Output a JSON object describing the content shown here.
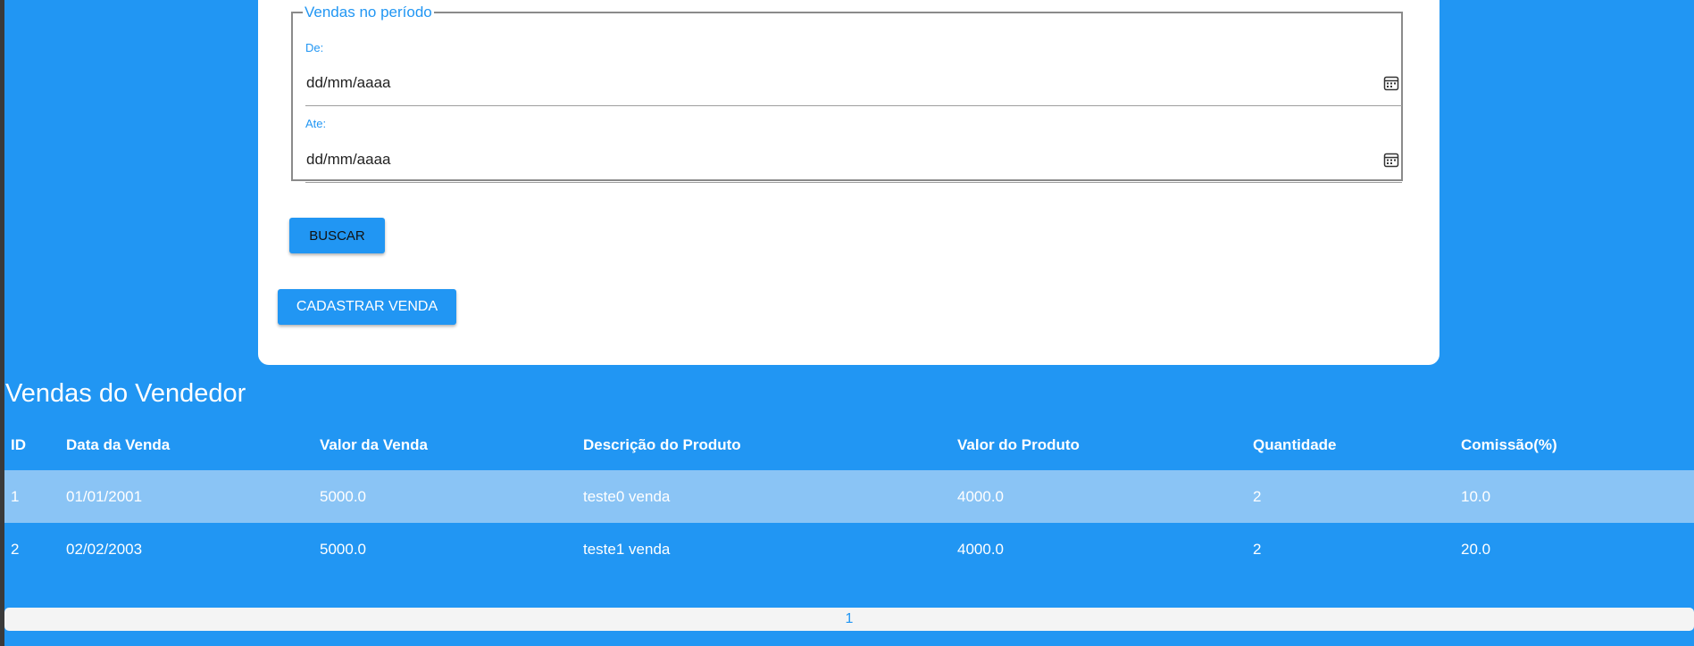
{
  "filter": {
    "legend": "Vendas no período",
    "from_label": "De:",
    "from_placeholder": "dd/mm/aaaa",
    "to_label": "Ate:",
    "to_placeholder": "dd/mm/aaaa",
    "search_button": "BUSCAR"
  },
  "register_button": "CADASTRAR VENDA",
  "sales": {
    "title": "Vendas do Vendedor",
    "headers": [
      "ID",
      "Data da Venda",
      "Valor da Venda",
      "Descrição do Produto",
      "Valor do Produto",
      "Quantidade",
      "Comissão(%)"
    ],
    "rows": [
      [
        "1",
        "01/01/2001",
        "5000.0",
        "teste0 venda",
        "4000.0",
        "2",
        "10.0"
      ],
      [
        "2",
        "02/02/2003",
        "5000.0",
        "teste1 venda",
        "4000.0",
        "2",
        "20.0"
      ]
    ]
  },
  "pagination": {
    "pages": [
      "1"
    ]
  },
  "icons": {
    "date_picker": "calendar-icon"
  },
  "colors": {
    "accent": "#2196f3",
    "highlight_row": "#8ac4f5",
    "card": "#ffffff"
  }
}
